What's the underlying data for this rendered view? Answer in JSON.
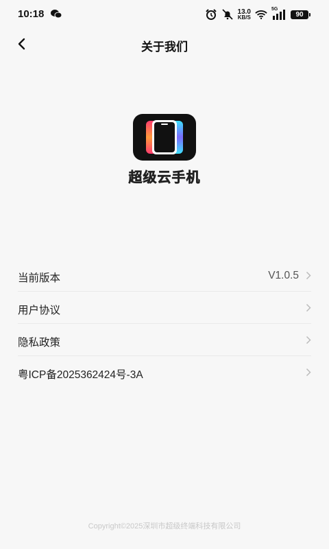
{
  "status_bar": {
    "time": "10:18",
    "net_speed_value": "13.0",
    "net_speed_unit": "KB/S",
    "network_type": "5G",
    "battery": "90",
    "icons": [
      "wechat-icon",
      "alarm-icon",
      "mute-bell-icon",
      "wifi-icon",
      "signal-icon",
      "battery-icon"
    ]
  },
  "nav": {
    "title": "关于我们",
    "back_icon": "chevron-left-icon"
  },
  "app": {
    "name": "超级云手机",
    "logo_icon": "phone-logo-icon"
  },
  "menu": {
    "items": [
      {
        "label": "当前版本",
        "value": "V1.0.5"
      },
      {
        "label": "用户协议",
        "value": ""
      },
      {
        "label": "隐私政策",
        "value": ""
      },
      {
        "label": "粤ICP备2025362424号-3A",
        "value": ""
      }
    ]
  },
  "footer": {
    "copyright": "Copyright©2025深圳市超级终端科技有限公司"
  },
  "colors": {
    "background": "#f7f7f7",
    "logo_bg": "#111111",
    "footer_text": "#c8c8c8"
  }
}
